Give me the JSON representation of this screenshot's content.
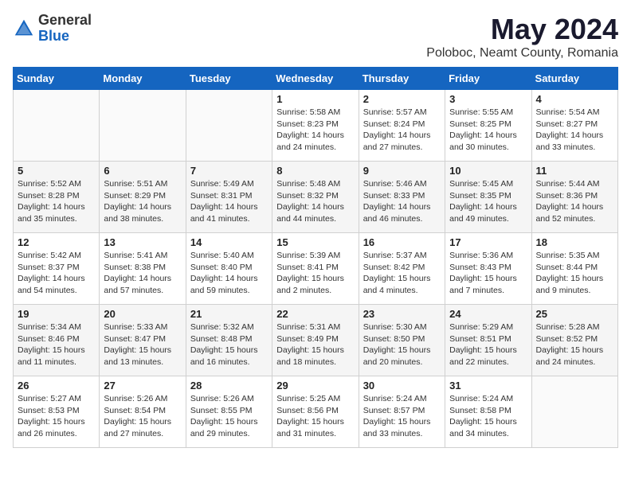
{
  "header": {
    "logo_general": "General",
    "logo_blue": "Blue",
    "main_title": "May 2024",
    "subtitle": "Poloboc, Neamt County, Romania"
  },
  "columns": [
    "Sunday",
    "Monday",
    "Tuesday",
    "Wednesday",
    "Thursday",
    "Friday",
    "Saturday"
  ],
  "weeks": [
    {
      "days": [
        {
          "number": "",
          "info": ""
        },
        {
          "number": "",
          "info": ""
        },
        {
          "number": "",
          "info": ""
        },
        {
          "number": "1",
          "info": "Sunrise: 5:58 AM\nSunset: 8:23 PM\nDaylight: 14 hours\nand 24 minutes."
        },
        {
          "number": "2",
          "info": "Sunrise: 5:57 AM\nSunset: 8:24 PM\nDaylight: 14 hours\nand 27 minutes."
        },
        {
          "number": "3",
          "info": "Sunrise: 5:55 AM\nSunset: 8:25 PM\nDaylight: 14 hours\nand 30 minutes."
        },
        {
          "number": "4",
          "info": "Sunrise: 5:54 AM\nSunset: 8:27 PM\nDaylight: 14 hours\nand 33 minutes."
        }
      ]
    },
    {
      "days": [
        {
          "number": "5",
          "info": "Sunrise: 5:52 AM\nSunset: 8:28 PM\nDaylight: 14 hours\nand 35 minutes."
        },
        {
          "number": "6",
          "info": "Sunrise: 5:51 AM\nSunset: 8:29 PM\nDaylight: 14 hours\nand 38 minutes."
        },
        {
          "number": "7",
          "info": "Sunrise: 5:49 AM\nSunset: 8:31 PM\nDaylight: 14 hours\nand 41 minutes."
        },
        {
          "number": "8",
          "info": "Sunrise: 5:48 AM\nSunset: 8:32 PM\nDaylight: 14 hours\nand 44 minutes."
        },
        {
          "number": "9",
          "info": "Sunrise: 5:46 AM\nSunset: 8:33 PM\nDaylight: 14 hours\nand 46 minutes."
        },
        {
          "number": "10",
          "info": "Sunrise: 5:45 AM\nSunset: 8:35 PM\nDaylight: 14 hours\nand 49 minutes."
        },
        {
          "number": "11",
          "info": "Sunrise: 5:44 AM\nSunset: 8:36 PM\nDaylight: 14 hours\nand 52 minutes."
        }
      ]
    },
    {
      "days": [
        {
          "number": "12",
          "info": "Sunrise: 5:42 AM\nSunset: 8:37 PM\nDaylight: 14 hours\nand 54 minutes."
        },
        {
          "number": "13",
          "info": "Sunrise: 5:41 AM\nSunset: 8:38 PM\nDaylight: 14 hours\nand 57 minutes."
        },
        {
          "number": "14",
          "info": "Sunrise: 5:40 AM\nSunset: 8:40 PM\nDaylight: 14 hours\nand 59 minutes."
        },
        {
          "number": "15",
          "info": "Sunrise: 5:39 AM\nSunset: 8:41 PM\nDaylight: 15 hours\nand 2 minutes."
        },
        {
          "number": "16",
          "info": "Sunrise: 5:37 AM\nSunset: 8:42 PM\nDaylight: 15 hours\nand 4 minutes."
        },
        {
          "number": "17",
          "info": "Sunrise: 5:36 AM\nSunset: 8:43 PM\nDaylight: 15 hours\nand 7 minutes."
        },
        {
          "number": "18",
          "info": "Sunrise: 5:35 AM\nSunset: 8:44 PM\nDaylight: 15 hours\nand 9 minutes."
        }
      ]
    },
    {
      "days": [
        {
          "number": "19",
          "info": "Sunrise: 5:34 AM\nSunset: 8:46 PM\nDaylight: 15 hours\nand 11 minutes."
        },
        {
          "number": "20",
          "info": "Sunrise: 5:33 AM\nSunset: 8:47 PM\nDaylight: 15 hours\nand 13 minutes."
        },
        {
          "number": "21",
          "info": "Sunrise: 5:32 AM\nSunset: 8:48 PM\nDaylight: 15 hours\nand 16 minutes."
        },
        {
          "number": "22",
          "info": "Sunrise: 5:31 AM\nSunset: 8:49 PM\nDaylight: 15 hours\nand 18 minutes."
        },
        {
          "number": "23",
          "info": "Sunrise: 5:30 AM\nSunset: 8:50 PM\nDaylight: 15 hours\nand 20 minutes."
        },
        {
          "number": "24",
          "info": "Sunrise: 5:29 AM\nSunset: 8:51 PM\nDaylight: 15 hours\nand 22 minutes."
        },
        {
          "number": "25",
          "info": "Sunrise: 5:28 AM\nSunset: 8:52 PM\nDaylight: 15 hours\nand 24 minutes."
        }
      ]
    },
    {
      "days": [
        {
          "number": "26",
          "info": "Sunrise: 5:27 AM\nSunset: 8:53 PM\nDaylight: 15 hours\nand 26 minutes."
        },
        {
          "number": "27",
          "info": "Sunrise: 5:26 AM\nSunset: 8:54 PM\nDaylight: 15 hours\nand 27 minutes."
        },
        {
          "number": "28",
          "info": "Sunrise: 5:26 AM\nSunset: 8:55 PM\nDaylight: 15 hours\nand 29 minutes."
        },
        {
          "number": "29",
          "info": "Sunrise: 5:25 AM\nSunset: 8:56 PM\nDaylight: 15 hours\nand 31 minutes."
        },
        {
          "number": "30",
          "info": "Sunrise: 5:24 AM\nSunset: 8:57 PM\nDaylight: 15 hours\nand 33 minutes."
        },
        {
          "number": "31",
          "info": "Sunrise: 5:24 AM\nSunset: 8:58 PM\nDaylight: 15 hours\nand 34 minutes."
        },
        {
          "number": "",
          "info": ""
        }
      ]
    }
  ]
}
